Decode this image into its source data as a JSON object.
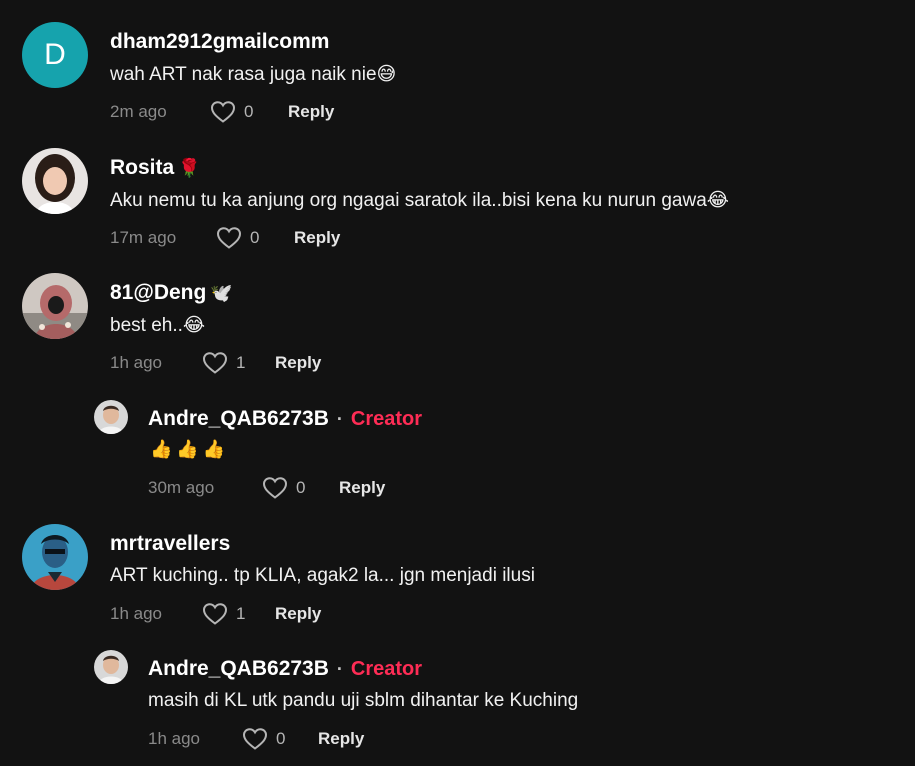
{
  "comments": [
    {
      "username": "dham2912gmailcomm",
      "text": "wah ART nak rasa juga naik nie😅",
      "time": "2m ago",
      "likes": "0",
      "reply_label": "Reply",
      "avatar_letter": "D",
      "avatar_color": "#16a3ad"
    },
    {
      "username": "Rosita",
      "badge": "🌹",
      "text": "Aku nemu tu ka anjung org ngagai saratok ila..bisi kena ku nurun gawa😂",
      "time": "17m ago",
      "likes": "0",
      "reply_label": "Reply"
    },
    {
      "username": "81@Deng",
      "badge": "🕊️",
      "text": "best eh..😂",
      "time": "1h ago",
      "likes": "1",
      "reply_label": "Reply"
    },
    {
      "username": "Andre_QAB6273B",
      "dot": "·",
      "creator_label": "Creator",
      "text": "👍👍👍",
      "time": "30m ago",
      "likes": "0",
      "reply_label": "Reply"
    },
    {
      "username": "mrtravellers",
      "text": "ART kuching.. tp KLIA, agak2 la... jgn menjadi ilusi",
      "time": "1h ago",
      "likes": "1",
      "reply_label": "Reply"
    },
    {
      "username": "Andre_QAB6273B",
      "dot": "·",
      "creator_label": "Creator",
      "text": "masih di KL utk pandu uji sblm dihantar ke Kuching",
      "time": "1h ago",
      "likes": "0",
      "reply_label": "Reply"
    }
  ],
  "colors": {
    "background": "#121212",
    "creator": "#fe2c55",
    "meta": "#8a8a8a"
  }
}
